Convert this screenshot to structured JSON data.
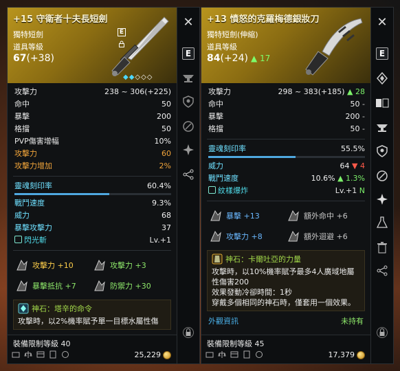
{
  "left": {
    "title": "+15 守衛者十夫長短劍",
    "subtype": "獨特短劍",
    "item_level_label": "道具等級",
    "item_level": "67",
    "item_level_bonus": "(+38)",
    "stats": [
      {
        "k": "攻擊力",
        "v": "238 ~ 306(+225)"
      },
      {
        "k": "命中",
        "v": "50"
      },
      {
        "k": "暴擊",
        "v": "200"
      },
      {
        "k": "格擋",
        "v": "50"
      },
      {
        "k": "PVP傷害增幅",
        "v": "10%"
      }
    ],
    "orange_stats": [
      {
        "k": "攻擊力",
        "v": "60"
      },
      {
        "k": "攻擊力增加",
        "v": "2%"
      }
    ],
    "soul_label": "靈魂刻印率",
    "soul_value": "60.4%",
    "soul_fill": 0.604,
    "stats2": [
      {
        "k": "戰鬥速度",
        "v": "9.3%"
      },
      {
        "k": "威力",
        "v": "68"
      },
      {
        "k": "暴擊攻擊力",
        "v": "37"
      }
    ],
    "set_name": "閃光斬",
    "set_level": "Lv.+1",
    "transmute": [
      {
        "label": "攻擊力 +10",
        "cls": "gold"
      },
      {
        "label": "攻擊力 +3",
        "cls": "g2"
      },
      {
        "label": "暴擊抵抗 +7",
        "cls": "g2"
      },
      {
        "label": "防禦力 +30",
        "cls": "g2"
      }
    ],
    "stone_title": "神石：塔辛的命令",
    "stone_text": "攻擊時，以2%機率賦予單一目標水屬性傷",
    "req_level": "裝備限制等級 40",
    "price": "25,229"
  },
  "right": {
    "title": "+13 憤怒的克羅梅德銀妝刀",
    "subtype": "獨特短劍(伸縮)",
    "item_level_label": "道具等級",
    "item_level": "84",
    "item_level_bonus": "(+24)",
    "item_level_up": "▲ 17",
    "stats": [
      {
        "k": "攻擊力",
        "v": "298 ~ 383(+185)",
        "d": "▲ 28",
        "dc": "green"
      },
      {
        "k": "命中",
        "v": "50",
        "d": "-",
        "dc": "dim"
      },
      {
        "k": "暴擊",
        "v": "200",
        "d": "-",
        "dc": "dim"
      },
      {
        "k": "格擋",
        "v": "50",
        "d": "-",
        "dc": "dim"
      }
    ],
    "soul_label": "靈魂刻印率",
    "soul_value": "55.5%",
    "soul_fill": 0.555,
    "stats2": [
      {
        "k": "威力",
        "v": "64",
        "d": "▼ 4",
        "dc": "red"
      },
      {
        "k": "戰鬥速度",
        "v": "10.6%",
        "d": "▲ 1.3%",
        "dc": "green"
      }
    ],
    "set_name": "紋樣爆炸",
    "set_level": "Lv.+1",
    "set_new": "N",
    "transmute": [
      {
        "label": "暴擊 +13",
        "cls": "blue"
      },
      {
        "label": "額外命中 +6",
        "cls": "grey"
      },
      {
        "label": "攻擊力 +8",
        "cls": "blue"
      },
      {
        "label": "額外迴避 +6",
        "cls": "grey"
      }
    ],
    "stone_title": "神石：卡爾吐亞的力量",
    "stone_lines": [
      "攻擊時，以10%機率賦予最多4人廣域地屬",
      "性傷害200",
      "效果發動冷卻時間：1秒",
      "穿戴多個相同的神石時，僅套用一個效果。"
    ],
    "looks_label": "外觀資訊",
    "looks_value": "未持有",
    "req_level": "裝備限制等級 45",
    "price": "17,379"
  },
  "icons": {
    "close": "close-icon",
    "equip": "equip-e-icon",
    "anvil": "anvil-icon",
    "shield": "shield-icon",
    "link": "link-icon",
    "star": "sparkle-icon",
    "share": "share-icon",
    "lock": "lock-icon",
    "compare": "compare-icon",
    "gem": "gem-icon",
    "flask": "flask-icon",
    "trash": "trash-icon",
    "crystal": "crystal-icon"
  }
}
